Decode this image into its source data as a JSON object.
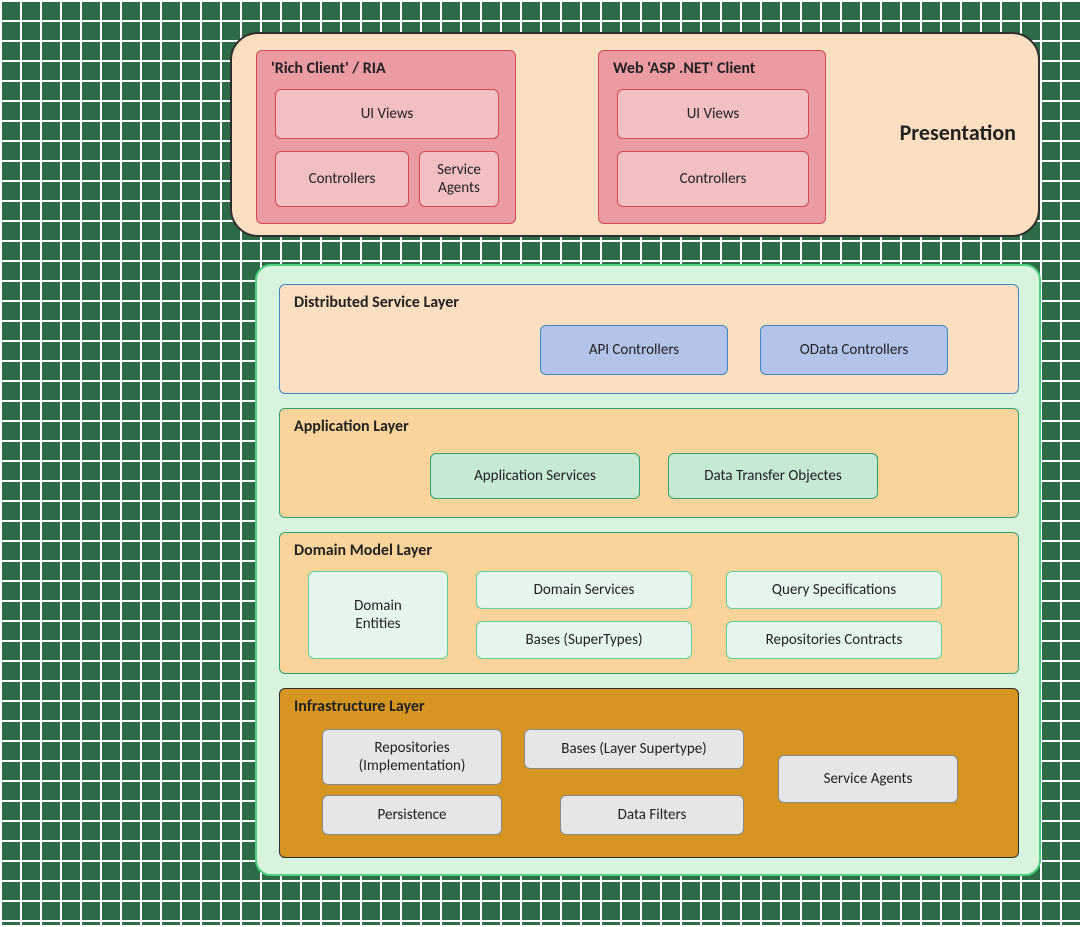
{
  "presentation": {
    "title": "Presentation",
    "rich_client": {
      "title": "'Rich Client' / RIA",
      "ui_views": "UI Views",
      "controllers": "Controllers",
      "service_agents": "Service\nAgents"
    },
    "web_client": {
      "title": "Web 'ASP .NET' Client",
      "ui_views": "UI Views",
      "controllers": "Controllers"
    }
  },
  "distributed": {
    "title": "Distributed Service Layer",
    "api_controllers": "API Controllers",
    "odata_controllers": "OData Controllers"
  },
  "application": {
    "title": "Application Layer",
    "application_services": "Application Services",
    "dtos": "Data Transfer Objectes"
  },
  "domain": {
    "title": "Domain Model Layer",
    "domain_entities": "Domain\nEntities",
    "domain_services": "Domain Services",
    "bases": "Bases (SuperTypes)",
    "query_specs": "Query Specifications",
    "repo_contracts": "Repositories Contracts"
  },
  "infrastructure": {
    "title": "Infrastructure Layer",
    "repositories_impl": "Repositories\n(Implementation)",
    "persistence": "Persistence",
    "bases": "Bases (Layer Supertype)",
    "data_filters": "Data Filters",
    "service_agents": "Service Agents"
  }
}
